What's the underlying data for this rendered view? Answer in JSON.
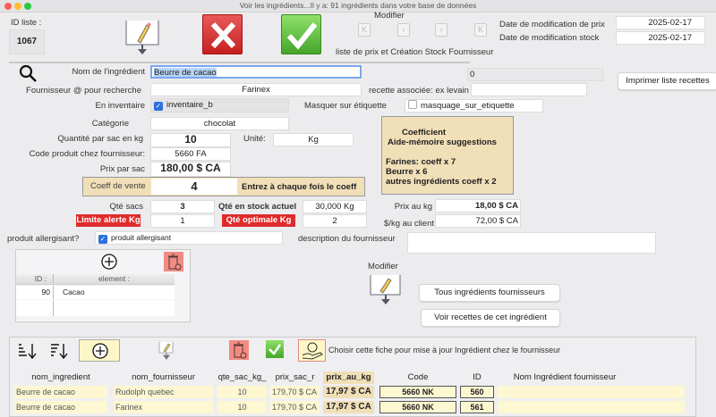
{
  "window": {
    "title": "Voir les ingrédients...Il y a: 91 ingrédients dans votre base de données"
  },
  "header": {
    "id_label": "ID liste :",
    "id_value": "1067",
    "modifier_label": "Modifier",
    "subtitle": "liste de prix et Création Stock Fournisseur",
    "date_prix_label": "Date de modification de prix",
    "date_prix": "2025-02-17",
    "date_stock_label": "Date de modification stock",
    "date_stock": "2025-02-17"
  },
  "form": {
    "nom_label": "Nom de l'ingrédient",
    "nom": "Beurre de cacao",
    "counter": "0",
    "print_button": "Imprimer liste recettes",
    "fournisseur_label": "Fournisseur @ pour recherche",
    "fournisseur": "Farinex",
    "recette_label": "recette associée: ex levain",
    "recette": "",
    "inventaire_label": "En inventaire",
    "inventaire": "inventaire_b",
    "inventaire_checked": true,
    "masquer_label": "Masquer sur étiquette",
    "masquer": "masquage_sur_etiquette",
    "masquer_checked": false,
    "categorie_label": "Catégorie",
    "categorie": "chocolat",
    "qte_sac_label": "Quantité par sac en kg",
    "qte_sac": "10",
    "unite_label": "Unité:",
    "unite": "Kg",
    "code_label": "Code produit chez fournisseur:",
    "code": "5660 FA",
    "prix_sac_label": "Prix par sac",
    "prix_sac": "180,00 $ CA",
    "coeff_label": "Coeff de vente",
    "coeff": "4",
    "coeff_hint": "Entrez à chaque fois le coeff",
    "memo_title1": "Coefficient",
    "memo_title2": "Aide-mémoire suggestions",
    "memo_l1": "Farines: coeff x 7",
    "memo_l2": "Beurre x 6",
    "memo_l3": "autres ingrédients coeff x 2",
    "qte_sacs_label": "Qté sacs",
    "qte_sacs": "3",
    "stock_label": "Qté en stock actuel",
    "stock": "30,000 Kg",
    "limite_label": "Limite alerte Kg",
    "limite": "1",
    "optimale_label": "Qté optimale Kg",
    "optimale": "2",
    "prix_kg_label": "Prix au kg",
    "prix_kg": "18,00 $ CA",
    "client_label": "$/kg au client",
    "client": "72,00 $ CA",
    "allergisant_label": "produit allergisant?",
    "allergisant": "produit allergisant",
    "allergisant_checked": true,
    "description_label": "description du fournisseur",
    "description": ""
  },
  "allergens": {
    "headers": [
      "ID :",
      "element :"
    ],
    "rows": [
      {
        "id": "90",
        "element": "Cacao"
      }
    ]
  },
  "actions": {
    "modifier_label": "Modifier",
    "tous_button": "Tous ingrédients fournisseurs",
    "voir_button": "Voir recettes de cet ingrédient"
  },
  "suppliers": {
    "choose_text": "Choisir cette fiche pour mise à jour Ingrédient chez le fournisseur",
    "headers": [
      "nom_ingredient",
      "nom_fournisseur",
      "qte_sac_kg_",
      "prix_sac_r",
      "prix_au_kg",
      "Code",
      "ID",
      "Nom Ingrédient fournisseur"
    ],
    "rows": [
      {
        "ing": "Beurre de cacao",
        "fourn": "Rudolph quebec",
        "qte": "10",
        "prix_sac": "179,70 $ CA",
        "prix_kg": "17,97 $ CA",
        "code": "5660 NK",
        "id": "560",
        "nom": ""
      },
      {
        "ing": "Beurre de cacao",
        "fourn": "Farinex",
        "qte": "10",
        "prix_sac": "179,70 $ CA",
        "prix_kg": "17,97 $ CA",
        "code": "5660 NK",
        "id": "561",
        "nom": ""
      }
    ]
  },
  "colors": {
    "alert_red": "#e02b2b",
    "tan": "#f1dfb8",
    "row_yellow": "#fdf7d2",
    "check_blue": "#2c6fe0"
  }
}
